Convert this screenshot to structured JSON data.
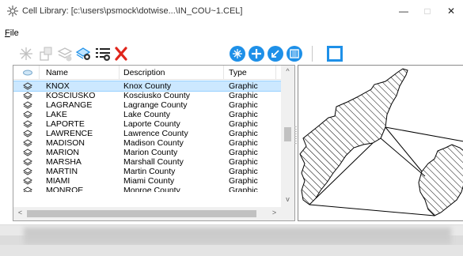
{
  "window": {
    "title": "Cell Library: [c:\\users\\psmock\\dotwise...\\IN_COU~1.CEL]",
    "minimize_icon": "minimize-icon",
    "maximize_icon": "maximize-icon",
    "close_icon": "close-icon"
  },
  "menu": {
    "file_mnemonic": "F",
    "file_rest": "ile"
  },
  "toolbar": {
    "icons": [
      "create-cell-icon",
      "share-cell-icon",
      "attach-library-icon",
      "place-cell-icon",
      "edit-cell-list-icon",
      "delete-icon",
      "create-icon",
      "add-icon",
      "edit-origin-icon",
      "select-icon",
      "preview-panel-icon"
    ],
    "accent_blue": "#1e90e8",
    "delete_red": "#e0251b"
  },
  "table": {
    "headers": {
      "icon": "",
      "name": "Name",
      "description": "Description",
      "type": "Type"
    },
    "rows": [
      {
        "name": "KNOX",
        "description": "Knox County",
        "type": "Graphic",
        "selected": true
      },
      {
        "name": "KOSCIUSKO",
        "description": "Kosciusko County",
        "type": "Graphic"
      },
      {
        "name": "LAGRANGE",
        "description": "Lagrange County",
        "type": "Graphic"
      },
      {
        "name": "LAKE",
        "description": "Lake County",
        "type": "Graphic"
      },
      {
        "name": "LAPORTE",
        "description": "Laporte County",
        "type": "Graphic"
      },
      {
        "name": "LAWRENCE",
        "description": "Lawrence County",
        "type": "Graphic"
      },
      {
        "name": "MADISON",
        "description": "Madison County",
        "type": "Graphic"
      },
      {
        "name": "MARION",
        "description": "Marion County",
        "type": "Graphic"
      },
      {
        "name": "MARSHA",
        "description": "Marshall County",
        "type": "Graphic"
      },
      {
        "name": "MARTIN",
        "description": "Martin County",
        "type": "Graphic"
      },
      {
        "name": "MIAMI",
        "description": "Miami County",
        "type": "Graphic"
      },
      {
        "name": "MONROE",
        "description": "Monroe County",
        "type": "Graphic"
      }
    ],
    "selected_bg": "#cce8ff",
    "scroll_up": "^",
    "scroll_down": "v",
    "scroll_left": "<",
    "scroll_right": ">"
  },
  "preview": {
    "label": ""
  }
}
